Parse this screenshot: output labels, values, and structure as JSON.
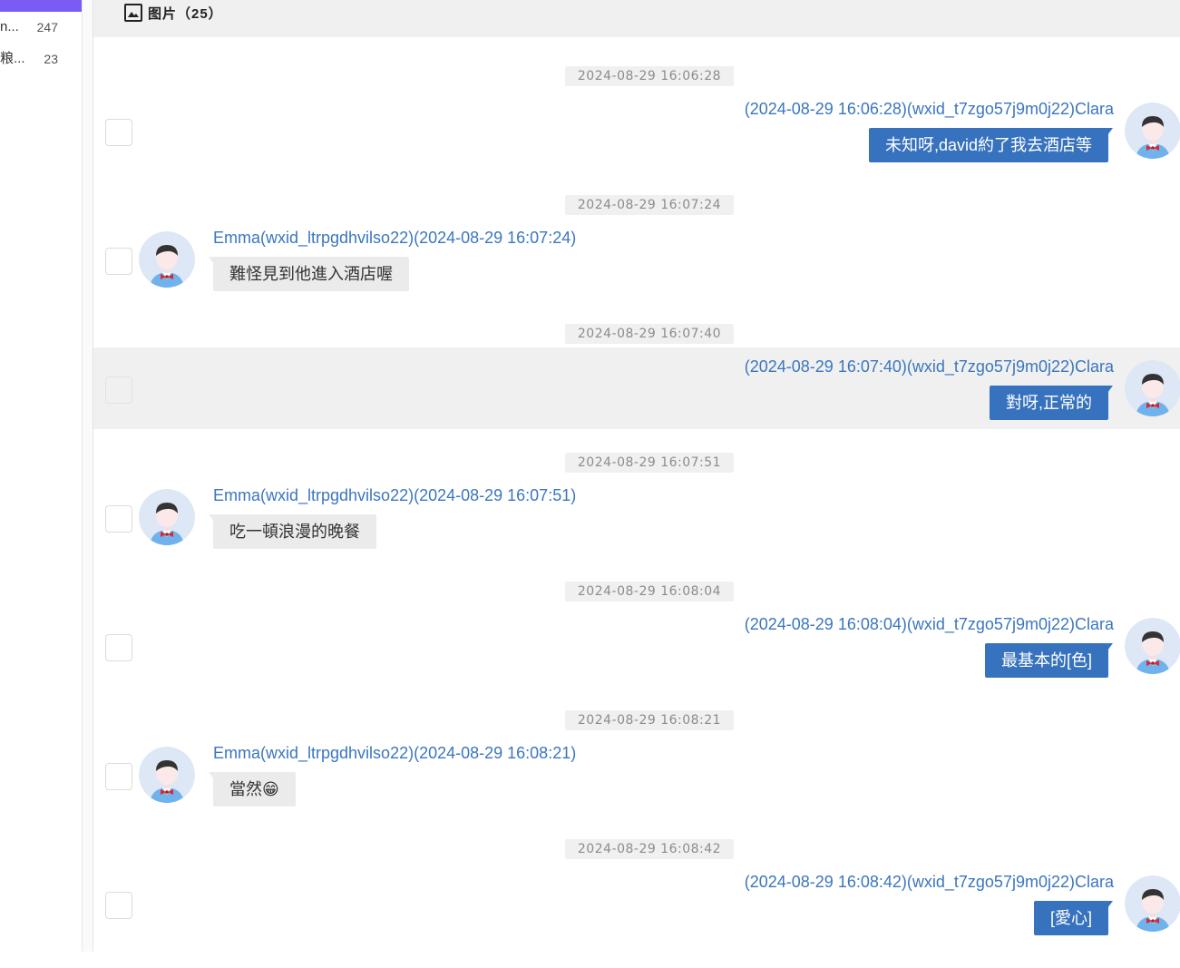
{
  "sidebar": {
    "items": [
      {
        "name": "n...",
        "count": "247"
      },
      {
        "name": "粮...",
        "count": "23"
      }
    ]
  },
  "tabs": {
    "images_label": "图片（25）"
  },
  "colors": {
    "accent": "#7a5cf5",
    "outgoing_bubble": "#3772be",
    "incoming_bubble": "#ebebeb",
    "sender_text": "#3b76c0",
    "highlight_row": "#f0f0f0"
  },
  "messages": [
    {
      "timestamp": "2024-08-29 16:06:28",
      "side": "right",
      "sender": "(2024-08-29 16:06:28)(wxid_t7zgo57j9m0j22)Clara",
      "text": "未知呀,david約了我去酒店等"
    },
    {
      "timestamp": "2024-08-29 16:07:24",
      "side": "left",
      "sender": "Emma(wxid_ltrpgdhvilso22)(2024-08-29 16:07:24)",
      "text": "難怪見到他進入酒店喔"
    },
    {
      "timestamp": "2024-08-29 16:07:40",
      "side": "right",
      "highlighted": true,
      "sender": "(2024-08-29 16:07:40)(wxid_t7zgo57j9m0j22)Clara",
      "text": "對呀,正常的"
    },
    {
      "timestamp": "2024-08-29 16:07:51",
      "side": "left",
      "sender": "Emma(wxid_ltrpgdhvilso22)(2024-08-29 16:07:51)",
      "text": "吃一頓浪漫的晚餐"
    },
    {
      "timestamp": "2024-08-29 16:08:04",
      "side": "right",
      "sender": "(2024-08-29 16:08:04)(wxid_t7zgo57j9m0j22)Clara",
      "text": "最基本的[色]"
    },
    {
      "timestamp": "2024-08-29 16:08:21",
      "side": "left",
      "sender": "Emma(wxid_ltrpgdhvilso22)(2024-08-29 16:08:21)",
      "text": "當然😁"
    },
    {
      "timestamp": "2024-08-29 16:08:42",
      "side": "right",
      "sender": "(2024-08-29 16:08:42)(wxid_t7zgo57j9m0j22)Clara",
      "text": "[愛心]"
    }
  ]
}
